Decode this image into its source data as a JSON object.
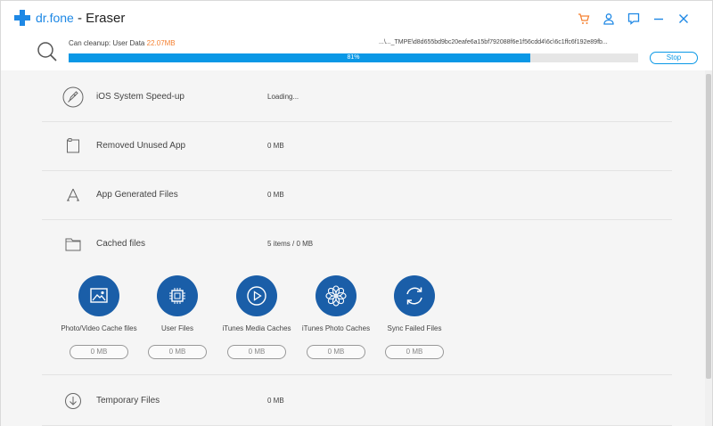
{
  "app": {
    "logo_text": "dr.fone",
    "title": "- Eraser"
  },
  "colors": {
    "accent": "#1e88e5",
    "progress": "#0a98e6",
    "highlight": "#f58233",
    "circle": "#1a5ea8"
  },
  "titlebar": {
    "icons": [
      "cart-icon",
      "user-icon",
      "feedback-icon",
      "minimize-icon",
      "close-icon"
    ]
  },
  "scan": {
    "cleanup_prefix": "Can cleanup: User Data",
    "cleanup_size": "22.07MB",
    "path": "...\\..._TMPE\\d8d655bd9bc20eafe6a15bf792088f6e1f56cdd4\\6c\\6c1ffc6f192e89fb...",
    "progress_percent": 81,
    "progress_label": "81%",
    "stop_label": "Stop"
  },
  "rows": [
    {
      "label": "iOS System Speed-up",
      "value": "Loading...",
      "icon": "rocket-icon"
    },
    {
      "label": "Removed Unused App",
      "value": "0 MB",
      "icon": "phone-app-icon"
    },
    {
      "label": "App Generated Files",
      "value": "0 MB",
      "icon": "app-store-icon"
    },
    {
      "label": "Cached files",
      "value": "5 items / 0 MB",
      "icon": "folder-icon"
    },
    {
      "label": "Temporary Files",
      "value": "0 MB",
      "icon": "download-circle-icon"
    }
  ],
  "cache_items": [
    {
      "name": "Photo/Video Cache files",
      "size": "0 MB",
      "icon": "image-icon"
    },
    {
      "name": "User Files",
      "size": "0 MB",
      "icon": "chip-icon"
    },
    {
      "name": "iTunes Media Caches",
      "size": "0 MB",
      "icon": "play-icon"
    },
    {
      "name": "iTunes Photo Caches",
      "size": "0 MB",
      "icon": "flower-icon"
    },
    {
      "name": "Sync Failed Files",
      "size": "0 MB",
      "icon": "sync-icon"
    }
  ]
}
